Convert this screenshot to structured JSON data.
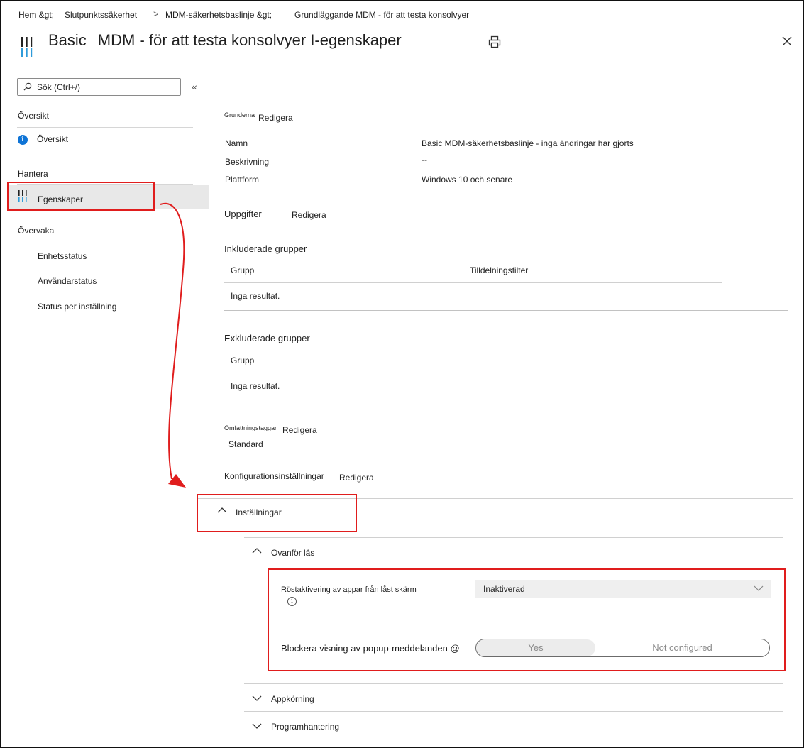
{
  "breadcrumb": {
    "items": [
      "Hem &gt;",
      "Slutpunktssäkerhet",
      "MDM-säkerhetsbaslinje &gt;",
      "Grundläggande MDM - för att testa konsolvyer"
    ],
    "separator": ">"
  },
  "header": {
    "title_part1": "Basic",
    "title_part2": "MDM - för att testa konsolvyer I-egenskaper",
    "print_icon": "printer-icon",
    "close_icon": "close-icon"
  },
  "sidebar": {
    "search_placeholder": "Sök (Ctrl+/)",
    "collapse_glyph": "«",
    "sections": [
      {
        "header": "Översikt",
        "items": [
          {
            "label": "Översikt",
            "icon": "info-icon"
          }
        ]
      },
      {
        "header": "Hantera",
        "items": [
          {
            "label": "Egenskaper",
            "icon": "properties-icon",
            "selected": true
          }
        ]
      },
      {
        "header": "Övervaka",
        "items": [
          {
            "label": "Enhetsstatus"
          },
          {
            "label": "Användarstatus"
          },
          {
            "label": "Status per inställning"
          }
        ]
      }
    ]
  },
  "main": {
    "basics": {
      "heading": "Grunderna",
      "edit_label": "Redigera",
      "rows": [
        {
          "label": "Namn",
          "value": "Basic  MDM-säkerhetsbaslinje - inga ändringar har gjorts"
        },
        {
          "label": "Beskrivning",
          "value": "--"
        },
        {
          "label": "Plattform",
          "value": "Windows 10 och senare"
        }
      ]
    },
    "assignments": {
      "heading": "Uppgifter",
      "edit_label": "Redigera",
      "included": {
        "heading": "Inkluderade grupper",
        "columns": [
          "Grupp",
          "Tilldelningsfilter"
        ],
        "empty": "Inga resultat."
      },
      "excluded": {
        "heading": "Exkluderade grupper",
        "columns": [
          "Grupp"
        ],
        "empty": "Inga resultat."
      }
    },
    "scope_tags": {
      "heading": "Omfattningstaggar",
      "edit_label": "Redigera",
      "value": "Standard"
    },
    "config": {
      "heading": "Konfigurationsinställningar",
      "edit_label": "Redigera",
      "settings_label": "Inställningar",
      "groups": [
        {
          "label": "Ovanför lås",
          "expanded": true,
          "settings": [
            {
              "label": "Röstaktivering av appar från låst skärm",
              "type": "dropdown",
              "value": "Inaktiverad"
            },
            {
              "label": "Blockera visning av popup-meddelanden @",
              "type": "toggle",
              "options": [
                "Yes",
                "Not configured"
              ]
            }
          ]
        },
        {
          "label": "Appkörning",
          "expanded": false
        },
        {
          "label": "Programhantering",
          "expanded": false
        }
      ]
    }
  },
  "colors": {
    "highlight_border": "#e01d1d",
    "arrow": "#e01d1d",
    "info_icon": "#0f74d6",
    "selected_bg": "#e8e8e8"
  }
}
